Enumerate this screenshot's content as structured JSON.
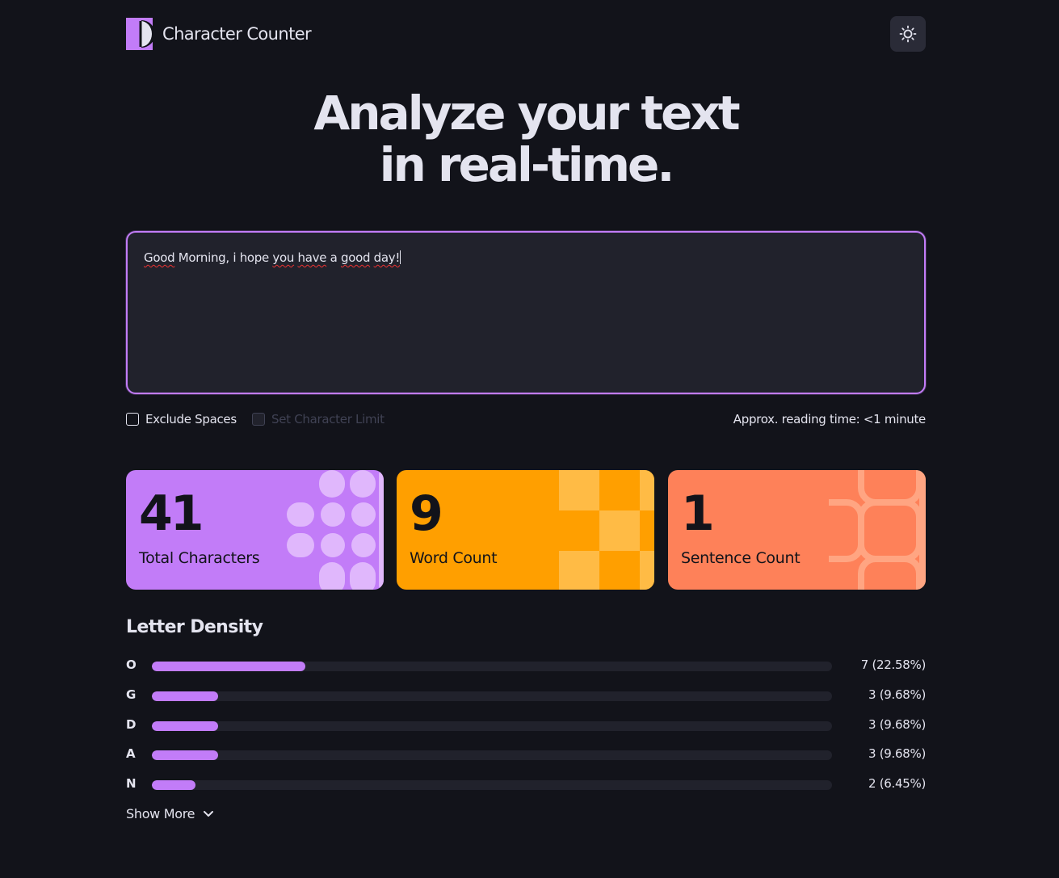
{
  "app": {
    "title": "Character Counter"
  },
  "hero": {
    "line1": "Analyze your text",
    "line2": "in real-time."
  },
  "editor": {
    "words": [
      {
        "t": "Good",
        "spell": true
      },
      {
        "t": " Morning, i ",
        "spell": false
      },
      {
        "t": "hope",
        "spell": false
      },
      {
        "t": " ",
        "spell": false
      },
      {
        "t": "you",
        "spell": true
      },
      {
        "t": " ",
        "spell": false
      },
      {
        "t": "have",
        "spell": true
      },
      {
        "t": " a ",
        "spell": false
      },
      {
        "t": "good",
        "spell": true
      },
      {
        "t": " ",
        "spell": false
      },
      {
        "t": "day!",
        "spell": true
      }
    ]
  },
  "options": {
    "exclude_spaces": "Exclude Spaces",
    "char_limit": "Set Character Limit",
    "reading_time": "Approx. reading time: <1 minute"
  },
  "stats": {
    "characters": {
      "value": "41",
      "label": "Total Characters"
    },
    "words": {
      "value": "9",
      "label": "Word Count"
    },
    "sentences": {
      "value": "1",
      "label": "Sentence Count"
    }
  },
  "density": {
    "title": "Letter Density",
    "rows": [
      {
        "letter": "O",
        "value": "7 (22.58%)",
        "fraction": 0.2258
      },
      {
        "letter": "G",
        "value": "3 (9.68%)",
        "fraction": 0.0968
      },
      {
        "letter": "D",
        "value": "3 (9.68%)",
        "fraction": 0.0968
      },
      {
        "letter": "A",
        "value": "3 (9.68%)",
        "fraction": 0.0968
      },
      {
        "letter": "N",
        "value": "2 (6.45%)",
        "fraction": 0.0645
      }
    ],
    "show_more": "Show More"
  },
  "colors": {
    "accent": "#c27cf8",
    "orange": "#ff9f00",
    "coral": "#fe8159",
    "background": "#12131a"
  }
}
